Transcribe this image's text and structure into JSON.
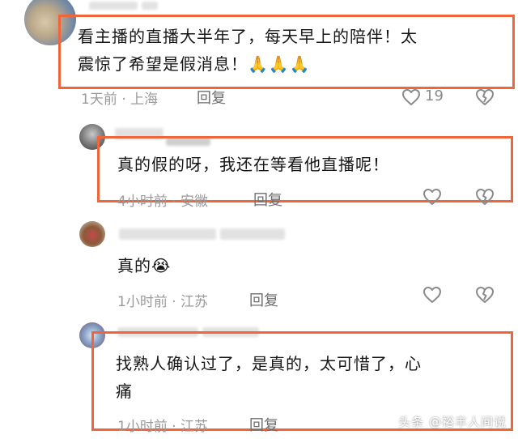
{
  "comments": [
    {
      "text_line1": "看主播的直播大半年了，每天早上的陪伴！太",
      "text_line2": "震惊了希望是假消息！🙏🙏🙏",
      "time": "1天前 · 上海",
      "reply_label": "回复",
      "like_count": "19"
    },
    {
      "text_line1": "真的假的呀，我还在等看他直播呢！",
      "time": "4小时前 · 安徽",
      "reply_label": "回复"
    },
    {
      "text_line1": "真的😭",
      "time": "1小时前 · 江苏",
      "reply_label": "回复"
    },
    {
      "text_line1": "找熟人确认过了，是真的，太可惜了，心",
      "text_line2": "痛",
      "time": "1小时前 · 江苏",
      "reply_label": "回复"
    }
  ],
  "watermark": "头条 @裕丰人间说",
  "colors": {
    "highlight": "#f0663a",
    "meta": "#9a9a9a",
    "background": "#ffffff"
  },
  "icons": [
    "heart-icon",
    "dislike-heart-icon",
    "avatar"
  ]
}
